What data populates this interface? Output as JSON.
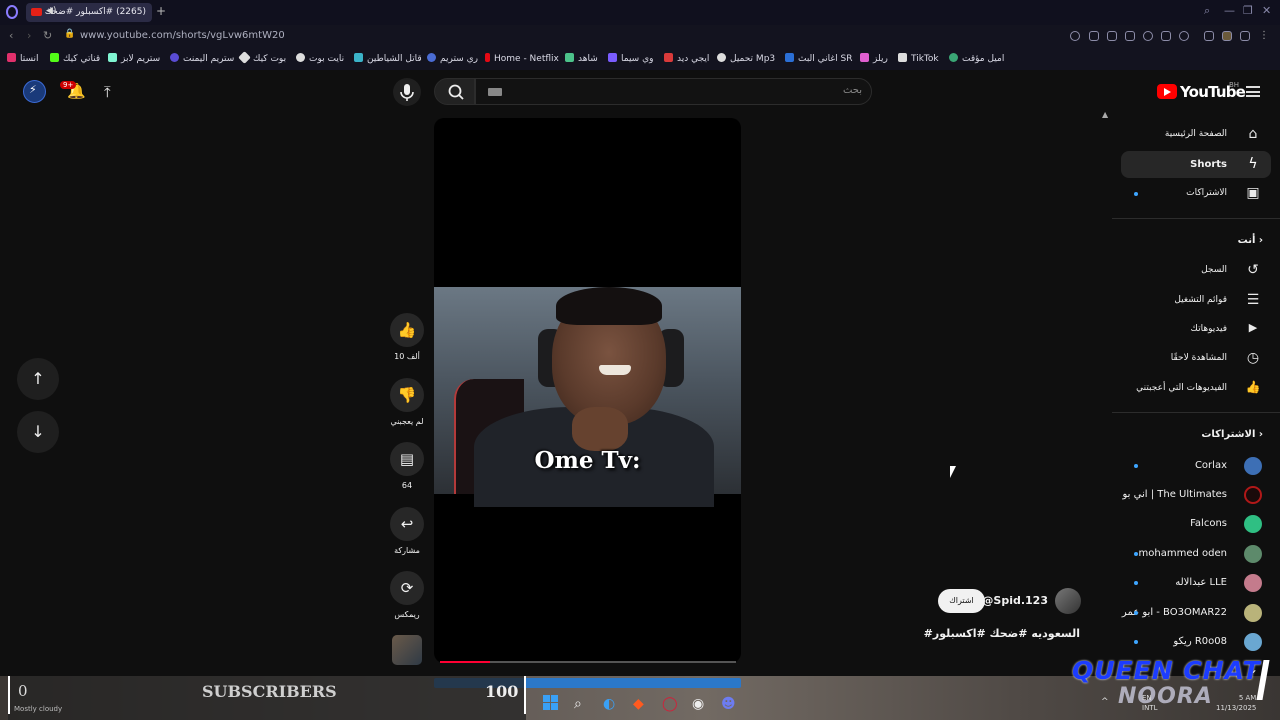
{
  "browser": {
    "tab_title": "(2265) #اكسبلور #ضحك",
    "url": "www.youtube.com/shorts/vgLvw6mtW20",
    "new_tab": "+",
    "bookmarks": [
      {
        "label": "اميل مؤقت",
        "color": "#3aa675"
      },
      {
        "label": "TikTok",
        "color": "#ffffff"
      },
      {
        "label": "ريلز",
        "color": "#e05fd0"
      },
      {
        "label": "اغاني البث SR",
        "color": "#2b6fd6"
      },
      {
        "label": "تحميل Mp3",
        "color": "#ffffff"
      },
      {
        "label": "ايجي ديد",
        "color": "#d93a3a"
      },
      {
        "label": "وي سيما",
        "color": "#7a5cff"
      },
      {
        "label": "شاهد",
        "color": "#4cc28a"
      },
      {
        "label": "Home - Netflix",
        "color": "#e50914"
      },
      {
        "label": "ري ستريم",
        "color": "#4a6cd4"
      },
      {
        "label": "قاتل الشياطين",
        "color": "#3bb3c9"
      },
      {
        "label": "نايت بوت",
        "color": "#dddddd"
      },
      {
        "label": "بوت كيك",
        "color": "#dddddd"
      },
      {
        "label": "ستريم اليمنت",
        "color": "#5a4cd4"
      },
      {
        "label": "ستريم لابز",
        "color": "#80f5d2"
      },
      {
        "label": "قناتي كيك",
        "color": "#53fc18"
      },
      {
        "label": "انستا",
        "color": "#e1306c"
      }
    ]
  },
  "header": {
    "search_placeholder": "بحث",
    "logo_text": "YouTube",
    "country_code": "BH",
    "notif_count": "9+"
  },
  "sidebar": {
    "main": [
      {
        "label": "الصفحة الرئيسية",
        "icon": "home-icon",
        "glyph": "⌂"
      },
      {
        "label": "Shorts",
        "icon": "shorts-icon",
        "glyph": "⚡"
      },
      {
        "label": "الاشتراكات",
        "icon": "subscriptions-icon",
        "glyph": "▣"
      }
    ],
    "you_heading": "أنت",
    "you": [
      {
        "label": "السجل",
        "icon": "history-icon",
        "glyph": "↺"
      },
      {
        "label": "قوائم التشغيل",
        "icon": "playlists-icon",
        "glyph": "☰"
      },
      {
        "label": "فيديوهاتك",
        "icon": "your-videos-icon",
        "glyph": "▶"
      },
      {
        "label": "المشاهدة لاحقًا",
        "icon": "watch-later-icon",
        "glyph": "◷"
      },
      {
        "label": "الفيديوهات التي أعجبتني",
        "icon": "liked-videos-icon",
        "glyph": "👍"
      }
    ],
    "subs_heading": "الاشتراكات",
    "subscriptions": [
      {
        "label": "Corlax",
        "dot": true,
        "color": "#3d6fb5"
      },
      {
        "label": "اني بو | The Ultimates",
        "dot": false,
        "color": "#b01818"
      },
      {
        "label": "Falcons",
        "dot": false,
        "color": "#2fbf83"
      },
      {
        "label": "mohammed oden",
        "dot": true,
        "color": "#5d8a6b"
      },
      {
        "label": "عبدالاله LLE",
        "dot": true,
        "color": "#c47b8c"
      },
      {
        "label": "ابو عمر - BO3OMAR22",
        "dot": true,
        "color": "#b9b37a"
      },
      {
        "label": "ريكو R0o08",
        "dot": true,
        "color": "#6aa7d1"
      }
    ]
  },
  "shorts": {
    "caption": "Ome Tv:",
    "progress": 0.17,
    "actions": {
      "like_count": "10 ألف",
      "dislike_label": "لم يعجبني",
      "comment_count": "64",
      "share_label": "مشاركة",
      "remix_label": "ريمكس"
    },
    "channel": "@Spid.123",
    "subscribe_label": "اشتراك",
    "title": "#السعوديه #ضحك #اكسبلور"
  },
  "overlay": {
    "sub_current": "0",
    "sub_word": "SUBSCRIBERS",
    "sub_goal": "100",
    "weather": "Mostly cloudy",
    "watermark_1": "QUEEN CHAT",
    "watermark_2": "NOORA",
    "tray_lang_1": "EN",
    "tray_lang_2": "INTL",
    "tray_time": "5 AM",
    "tray_date": "11/13/2025"
  }
}
